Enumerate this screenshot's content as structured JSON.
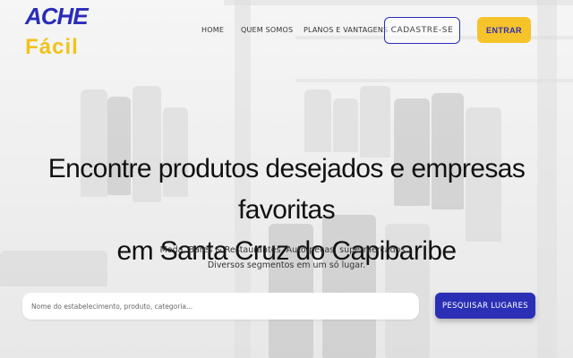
{
  "header": {
    "logo_top": "ACHE",
    "logo_bottom": "Fácil",
    "nav": [
      {
        "label": "HOME"
      },
      {
        "label": "QUEM SOMOS"
      },
      {
        "label": "PLANOS E VANTAGENS"
      }
    ],
    "signup_label": "CADASTRE-SE",
    "login_label": "ENTRAR"
  },
  "hero": {
    "headline_line1": "Encontre produtos desejados e empresas favoritas",
    "headline_line2": "em Santa Cruz do Capibaribe",
    "subline_line1": "Moda, Bares & Restaurantes, Auto-peças, supermercados...",
    "subline_line2": "Diversos segmentos em um só lugar."
  },
  "search": {
    "placeholder": "Nome do estabelecimento, produto, categoria...",
    "value": "",
    "button_label": "PESQUISAR LUGARES"
  },
  "colors": {
    "brand_blue": "#2a2db8",
    "brand_yellow": "#f6c32a"
  }
}
